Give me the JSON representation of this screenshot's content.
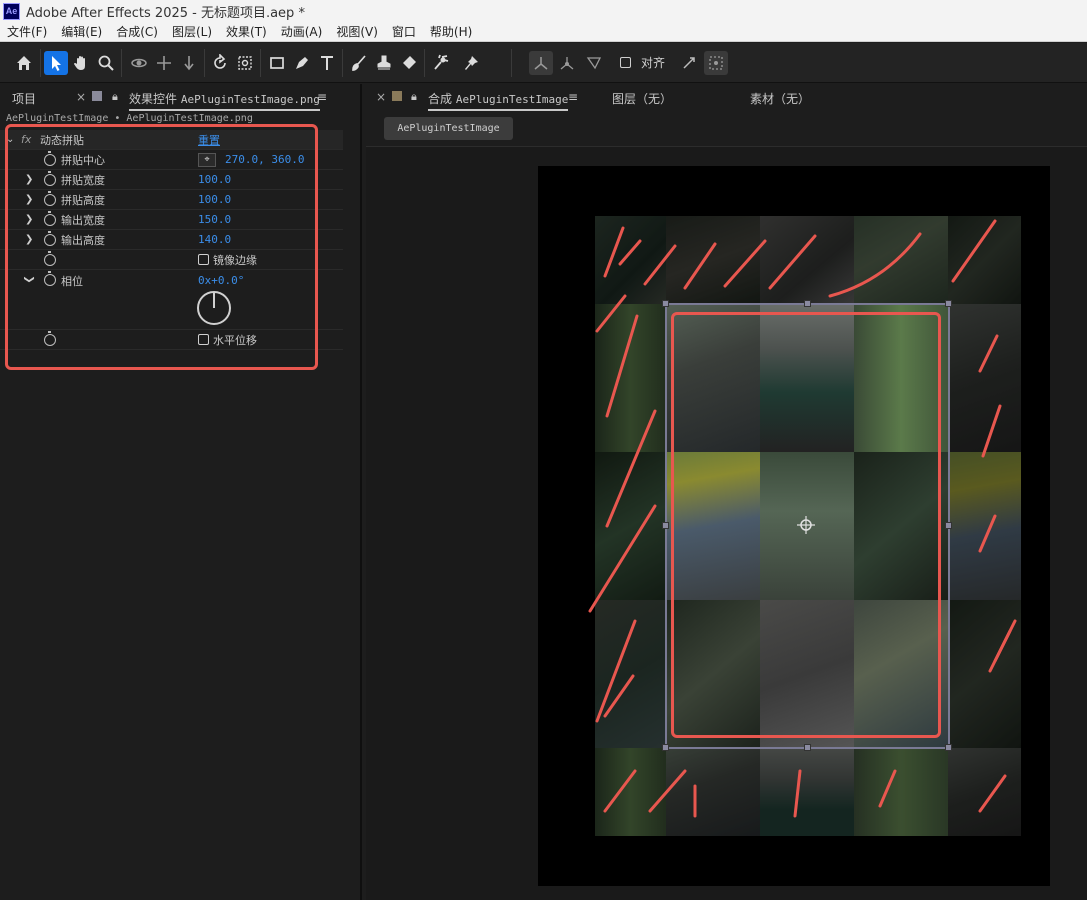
{
  "app": {
    "logo": "Ae",
    "title": "Adobe After Effects 2025 - 无标题项目.aep *"
  },
  "menu": [
    "文件(F)",
    "编辑(E)",
    "合成(C)",
    "图层(L)",
    "效果(T)",
    "动画(A)",
    "视图(V)",
    "窗口",
    "帮助(H)"
  ],
  "toolbar": {
    "snap_label": "对齐",
    "icons": [
      "home-icon",
      "selection-arrow-icon",
      "hand-icon",
      "zoom-icon",
      "orbit-camera-icon",
      "pan-camera-icon",
      "dolly-camera-icon",
      "rotate-icon",
      "pan-behind-icon",
      "rectangle-icon",
      "pen-icon",
      "text-icon",
      "brush-icon",
      "clone-stamp-icon",
      "eraser-icon",
      "roto-brush-icon",
      "puppet-pin-icon"
    ]
  },
  "left_panel": {
    "tab_project": "项目",
    "tab_effects": "效果控件",
    "tab_effects_file": "AePluginTestImage.png",
    "breadcrumb": "AePluginTestImage • AePluginTestImage.png",
    "effect_name": "动态拼贴",
    "fx_badge": "fx",
    "reset_label": "重置",
    "params": [
      {
        "label": "拼贴中心",
        "value": "270.0, 360.0"
      },
      {
        "label": "拼贴宽度",
        "value": "100.0"
      },
      {
        "label": "拼贴高度",
        "value": "100.0"
      },
      {
        "label": "输出宽度",
        "value": "150.0"
      },
      {
        "label": "输出高度",
        "value": "140.0"
      },
      {
        "label": "镜像边缘",
        "value": ""
      },
      {
        "label": "相位",
        "value": "0x+0.0°"
      },
      {
        "label": "水平位移",
        "value": ""
      }
    ]
  },
  "right_panel": {
    "tab_comp": "合成",
    "tab_comp_name": "AePluginTestImage",
    "tab_layer": "图层（无）",
    "tab_footage": "素材（无）",
    "comp_chip": "AePluginTestImage"
  },
  "colors": {
    "accent": "#1473e6",
    "value_blue": "#3b8eea",
    "annotation_red": "#e8574f"
  }
}
